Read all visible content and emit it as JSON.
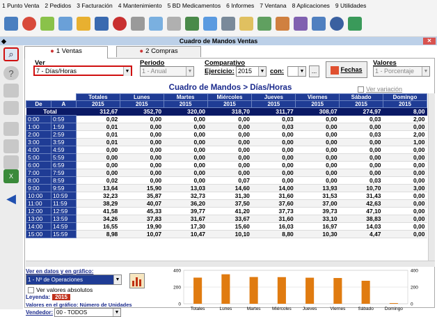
{
  "menu": [
    "1 Punto Venta",
    "2 Pedidos",
    "3 Facturación",
    "4 Mantenimiento",
    "5 BD Medicamentos",
    "6 Informes",
    "7 Ventana",
    "8 Aplicaciones",
    "9 Utilidades"
  ],
  "window": {
    "title": "Cuadro de Mandos Ventas",
    "close": "✕"
  },
  "tabs": [
    {
      "label": "1 Ventas"
    },
    {
      "label": "2 Compras"
    }
  ],
  "filters": {
    "ver_label": "Ver",
    "ver_value": "7 - Días/Horas",
    "periodo_label": "Periodo",
    "periodo_value": "1 - Anual",
    "comparativo_label": "Comparativo",
    "ejercicio_label": "Ejercicio:",
    "ejercicio_value": "2015",
    "con_label": "con:",
    "con_value": "",
    "ellipsis": "...",
    "fechas_button": "Fechas",
    "valores_label": "Valores",
    "valores_value": "1 - Porcentaje"
  },
  "chart_title": "Cuadro de Mandos > Días/Horas",
  "ver_variacion": "Ver variación",
  "table": {
    "columns": [
      "Totales",
      "Lunes",
      "Martes",
      "Miércoles",
      "Jueves",
      "Viernes",
      "Sábado",
      "Domingo"
    ],
    "year": "2015",
    "de": "De",
    "a": "A",
    "total_label": "Total",
    "totals": [
      "312,67",
      "352,70",
      "320,00",
      "318,70",
      "311,77",
      "308,07",
      "274,97",
      "8,00"
    ],
    "rows": [
      {
        "de": "0:00",
        "a": "0:59",
        "v": [
          "0,02",
          "0,00",
          "0,00",
          "0,00",
          "0,03",
          "0,00",
          "0,03",
          "2,00"
        ]
      },
      {
        "de": "1:00",
        "a": "1:59",
        "v": [
          "0,01",
          "0,00",
          "0,00",
          "0,00",
          "0,03",
          "0,00",
          "0,00",
          "0,00"
        ]
      },
      {
        "de": "2:00",
        "a": "2:59",
        "v": [
          "0,01",
          "0,00",
          "0,00",
          "0,00",
          "0,00",
          "0,00",
          "0,03",
          "2,00"
        ]
      },
      {
        "de": "3:00",
        "a": "3:59",
        "v": [
          "0,01",
          "0,00",
          "0,00",
          "0,00",
          "0,00",
          "0,00",
          "0,00",
          "1,00"
        ]
      },
      {
        "de": "4:00",
        "a": "4:59",
        "v": [
          "0,00",
          "0,00",
          "0,00",
          "0,00",
          "0,00",
          "0,00",
          "0,00",
          "0,00"
        ]
      },
      {
        "de": "5:00",
        "a": "5:59",
        "v": [
          "0,00",
          "0,00",
          "0,00",
          "0,00",
          "0,00",
          "0,00",
          "0,00",
          "0,00"
        ]
      },
      {
        "de": "6:00",
        "a": "6:59",
        "v": [
          "0,00",
          "0,00",
          "0,00",
          "0,00",
          "0,00",
          "0,00",
          "0,00",
          "0,00"
        ]
      },
      {
        "de": "7:00",
        "a": "7:59",
        "v": [
          "0,00",
          "0,00",
          "0,00",
          "0,00",
          "0,00",
          "0,00",
          "0,00",
          "0,00"
        ]
      },
      {
        "de": "8:00",
        "a": "8:59",
        "v": [
          "0,02",
          "0,00",
          "0,00",
          "0,07",
          "0,00",
          "0,00",
          "0,03",
          "0,00"
        ]
      },
      {
        "de": "9:00",
        "a": "9:59",
        "v": [
          "13,64",
          "15,90",
          "13,03",
          "14,60",
          "14,00",
          "13,93",
          "10,70",
          "3,00"
        ]
      },
      {
        "de": "10:00",
        "a": "10:59",
        "v": [
          "32,23",
          "35,87",
          "32,73",
          "31,30",
          "31,60",
          "31,53",
          "31,43",
          "0,00"
        ]
      },
      {
        "de": "11:00",
        "a": "11:59",
        "v": [
          "38,29",
          "40,07",
          "36,20",
          "37,50",
          "37,60",
          "37,00",
          "42,63",
          "0,00"
        ]
      },
      {
        "de": "12:00",
        "a": "12:59",
        "v": [
          "41,58",
          "45,33",
          "39,77",
          "41,20",
          "37,73",
          "39,73",
          "47,10",
          "0,00"
        ]
      },
      {
        "de": "13:00",
        "a": "13:59",
        "v": [
          "34,26",
          "37,83",
          "31,67",
          "33,67",
          "31,60",
          "33,10",
          "38,83",
          "0,00"
        ]
      },
      {
        "de": "14:00",
        "a": "14:59",
        "v": [
          "16,55",
          "19,90",
          "17,30",
          "15,60",
          "16,03",
          "16,97",
          "14,03",
          "0,00"
        ]
      },
      {
        "de": "15:00",
        "a": "15:59",
        "v": [
          "8,98",
          "10,07",
          "10,47",
          "10,10",
          "8,80",
          "10,30",
          "4,47",
          "0,00"
        ]
      }
    ]
  },
  "bottom": {
    "ver_en_datos": "Ver en datos y en gráfico:",
    "datos_value": "1 - Nº de Operaciones",
    "ver_absolutos": "Ver valores absolutos",
    "leyenda_label": "Leyenda:",
    "leyenda_value": "2015",
    "valores_grafico": "Valores en el gráfico: Número de Unidades",
    "vendedor_label": "Vendedor:",
    "vendedor_value": "00 - TODOS"
  },
  "chart_data": {
    "type": "bar",
    "categories": [
      "Totales",
      "Lunes",
      "Martes",
      "Miércoles",
      "Jueves",
      "Viernes",
      "Sábado",
      "Domingo"
    ],
    "values": [
      312.67,
      352.7,
      320.0,
      318.7,
      311.77,
      308.07,
      274.97,
      8.0
    ],
    "ylim": [
      0,
      400
    ],
    "yticks": [
      "400",
      "200",
      "0"
    ],
    "bar_color": "#e07b10"
  }
}
